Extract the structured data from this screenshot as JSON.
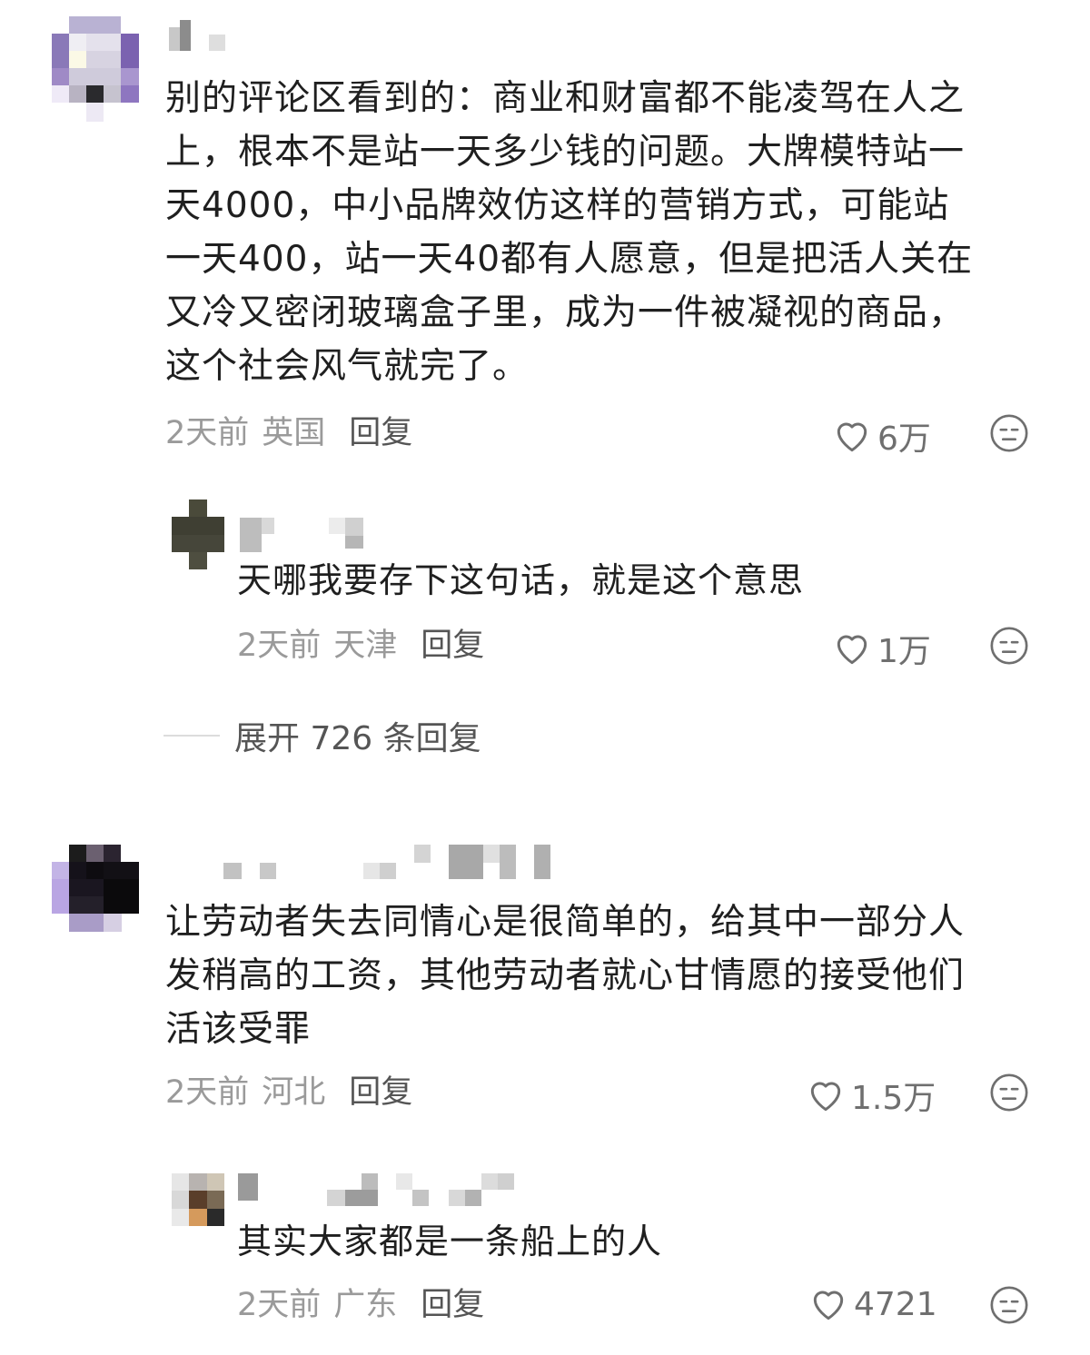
{
  "comments": [
    {
      "text": "别的评论区看到的：商业和财富都不能凌驾在人之\n上，根本不是站一天多少钱的问题。大牌模特站一\n天4000，中小品牌效仿这样的营销方式，可能站\n一天400，站一天40都有人愿意，但是把活人关在\n又冷又密闭玻璃盒子里，成为一件被凝视的商品，\n这个社会风气就完了。",
      "time": "2天前",
      "location": "英国",
      "reply_label": "回复",
      "likes": "6万",
      "replies": [
        {
          "text": "天哪我要存下这句话，就是这个意思",
          "time": "2天前",
          "location": "天津",
          "reply_label": "回复",
          "likes": "1万"
        }
      ],
      "expand_label": "展开 726 条回复"
    },
    {
      "text": "让劳动者失去同情心是很简单的，给其中一部分人\n发稍高的工资，其他劳动者就心甘情愿的接受他们\n活该受罪",
      "time": "2天前",
      "location": "河北",
      "reply_label": "回复",
      "likes": "1.5万",
      "replies": [
        {
          "text": "其实大家都是一条船上的人",
          "time": "2天前",
          "location": "广东",
          "reply_label": "回复",
          "likes": "4721"
        }
      ]
    }
  ],
  "icons": {
    "like": "heart-outline-icon",
    "dislike": "unamused-face-icon"
  },
  "colors": {
    "text": "#1f1f1f",
    "meta": "#9a9a9a",
    "reply_button": "#555555",
    "icon": "#6f6f6f"
  }
}
